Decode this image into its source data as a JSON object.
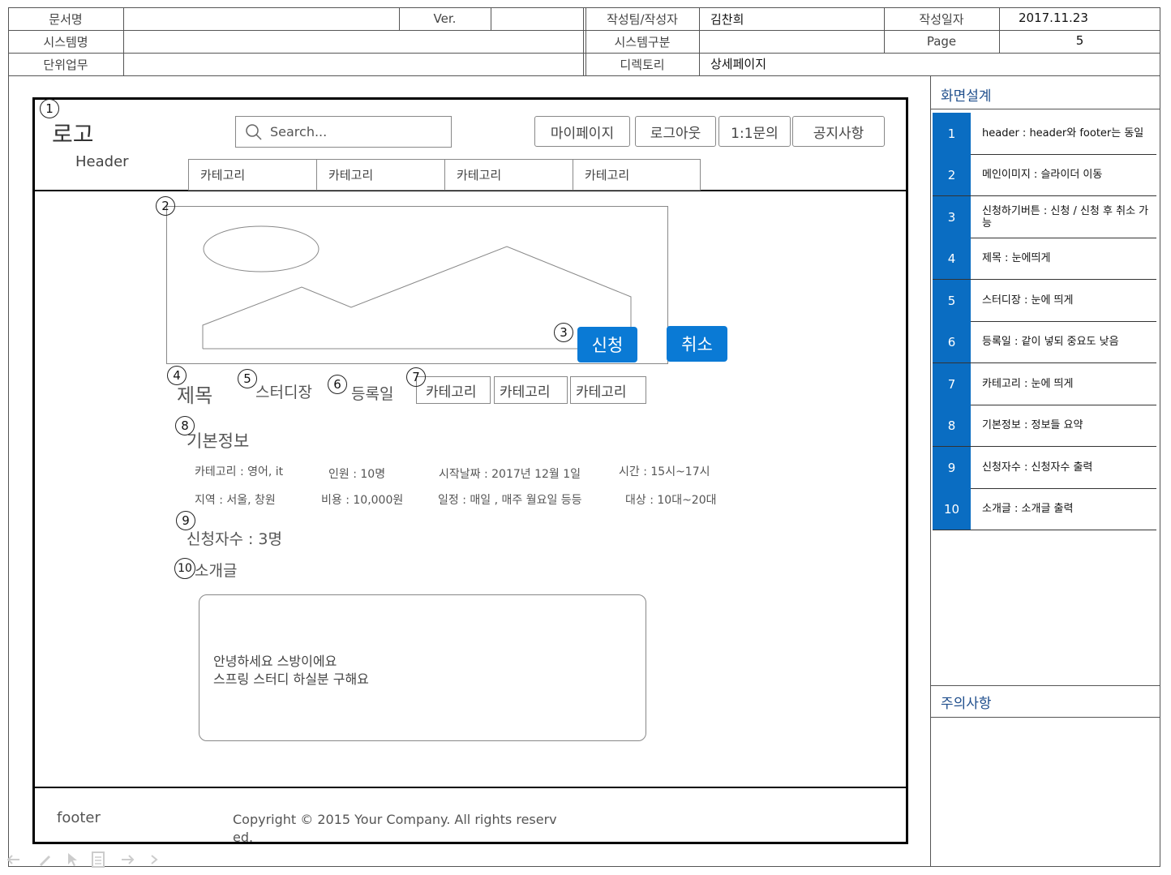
{
  "doc_header": {
    "doc_name_label": "문서명",
    "ver_label": "Ver.",
    "author_label": "작성팀/작성자",
    "author_value": "김찬희",
    "date_label": "작성일자",
    "date_value": "2017.11.23",
    "system_name_label": "시스템명",
    "system_type_label": "시스템구분",
    "page_label": "Page",
    "page_value": "5",
    "unit_task_label": "단위업무",
    "directory_label": "디렉토리",
    "directory_value": "상세페이지"
  },
  "wireframe": {
    "logo": "로고",
    "header_label": "Header",
    "search_placeholder": "Search...",
    "nav_buttons": [
      "마이페이지",
      "로그아웃",
      "1:1문의",
      "공지사항"
    ],
    "category_tabs": [
      "카테고리",
      "카테고리",
      "카테고리",
      "카테고리"
    ],
    "apply_button": "신청",
    "cancel_button": "취소",
    "title": "제목",
    "study_leader": "스터디장",
    "reg_date": "등록일",
    "detail_categories": [
      "카테고리",
      "카테고리",
      "카테고리"
    ],
    "basic_info_title": "기본정보",
    "info": {
      "category": "카테고리 :  영어, it",
      "people": "인원 : 10명",
      "start_date": "시작날짜 : 2017년 12월 1일",
      "time": "시간 :  15시~17시",
      "region": "지역 :  서울, 창원",
      "cost": "비용 : 10,000원",
      "schedule": "일정 : 매일 , 매주 월요일 등등",
      "target": "대상 : 10대~20대"
    },
    "applicants": "신청자수 : 3명",
    "intro_title": "소개글",
    "intro_line1": "안녕하세요 스방이에요",
    "intro_line2": "스프링 스터디 하실분 구해요",
    "footer_label": "footer",
    "copyright_line1": "Copyright © 2015 Your Company. All rights reserv",
    "copyright_line2": "ed.",
    "markers": [
      "1",
      "2",
      "3",
      "4",
      "5",
      "6",
      "7",
      "8",
      "9",
      "10"
    ]
  },
  "side_panel": {
    "screen_design_title": "화면설계",
    "notes_title": "주의사항",
    "annotations": [
      {
        "num": "1",
        "text": "header : header와 footer는 동일"
      },
      {
        "num": "2",
        "text": "메인이미지 : 슬라이더 이동"
      },
      {
        "num": "3",
        "text": "신청하기버튼 : 신청 / 신청 후 취소 가능"
      },
      {
        "num": "4",
        "text": "제목 : 눈에띄게"
      },
      {
        "num": "5",
        "text": "스터디장 : 눈에 띄게"
      },
      {
        "num": "6",
        "text": "등록일 : 같이 넣되 중요도 낮음"
      },
      {
        "num": "7",
        "text": "카테고리 : 눈에 띄게"
      },
      {
        "num": "8",
        "text": "기본정보 : 정보들 요약"
      },
      {
        "num": "9",
        "text": "신청자수 : 신청자수 출력"
      },
      {
        "num": "10",
        "text": "소개글 : 소개글 출력"
      }
    ]
  },
  "colors": {
    "accent_blue": "#0a7ad5",
    "panel_blue": "#0a6dc2",
    "title_blue": "#1f4e8c"
  },
  "toolbar_icons": [
    "arrow-left-icon",
    "pencil-icon",
    "pointer-icon",
    "page-icon",
    "arrow-right-icon",
    "chevron-right-icon"
  ]
}
